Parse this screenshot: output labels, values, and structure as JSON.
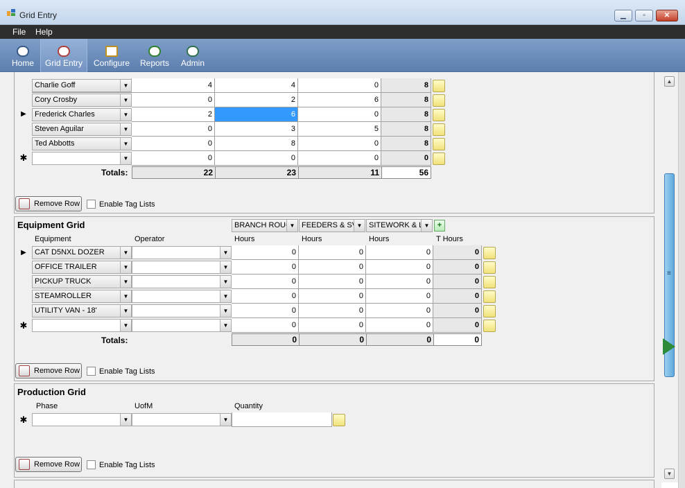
{
  "window": {
    "title": "Grid Entry"
  },
  "menu": [
    "File",
    "Help"
  ],
  "toolbar": [
    {
      "label": "Home",
      "icon": "home-icon"
    },
    {
      "label": "Grid Entry",
      "icon": "grid-entry-icon",
      "active": true
    },
    {
      "label": "Configure",
      "icon": "configure-icon"
    },
    {
      "label": "Reports",
      "icon": "reports-icon"
    },
    {
      "label": "Admin",
      "icon": "admin-icon"
    }
  ],
  "labor": {
    "rows": [
      {
        "name": "Charlie Goff",
        "h1": "4",
        "h2": "4",
        "h3": "0",
        "total": "8"
      },
      {
        "name": "Cory Crosby",
        "h1": "0",
        "h2": "2",
        "h3": "6",
        "total": "8"
      },
      {
        "name": "Frederick Charles",
        "h1": "2",
        "h2": "6",
        "h3": "0",
        "total": "8"
      },
      {
        "name": "Steven Aguilar",
        "h1": "0",
        "h2": "3",
        "h3": "5",
        "total": "8"
      },
      {
        "name": "Ted Abbotts",
        "h1": "0",
        "h2": "8",
        "h3": "0",
        "total": "8"
      },
      {
        "name": "",
        "h1": "0",
        "h2": "0",
        "h3": "0",
        "total": "0"
      }
    ],
    "totals_label": "Totals:",
    "totals": [
      "22",
      "23",
      "11",
      "56"
    ],
    "remove_button": "Remove Row",
    "tag_lists": "Enable Tag Lists"
  },
  "equipment": {
    "title": "Equipment Grid",
    "phases": [
      "BRANCH ROUC",
      "FEEDERS & SV",
      "SITEWORK & L"
    ],
    "columns": [
      "Equipment",
      "Operator",
      "Hours",
      "Hours",
      "Hours",
      "T Hours"
    ],
    "rows": [
      {
        "name": "CAT D5NXL DOZER",
        "h1": "0",
        "h2": "0",
        "h3": "0",
        "total": "0"
      },
      {
        "name": "OFFICE TRAILER",
        "h1": "0",
        "h2": "0",
        "h3": "0",
        "total": "0"
      },
      {
        "name": "PICKUP TRUCK",
        "h1": "0",
        "h2": "0",
        "h3": "0",
        "total": "0"
      },
      {
        "name": "STEAMROLLER",
        "h1": "0",
        "h2": "0",
        "h3": "0",
        "total": "0"
      },
      {
        "name": "UTILITY VAN - 18'",
        "h1": "0",
        "h2": "0",
        "h3": "0",
        "total": "0"
      },
      {
        "name": "",
        "h1": "0",
        "h2": "0",
        "h3": "0",
        "total": "0"
      }
    ],
    "totals_label": "Totals:",
    "totals": [
      "0",
      "0",
      "0",
      "0"
    ],
    "remove_button": "Remove Row",
    "tag_lists": "Enable Tag Lists"
  },
  "production": {
    "title": "Production Grid",
    "columns": [
      "Phase",
      "UofM",
      "Quantity"
    ],
    "remove_button": "Remove Row",
    "tag_lists": "Enable Tag Lists"
  }
}
